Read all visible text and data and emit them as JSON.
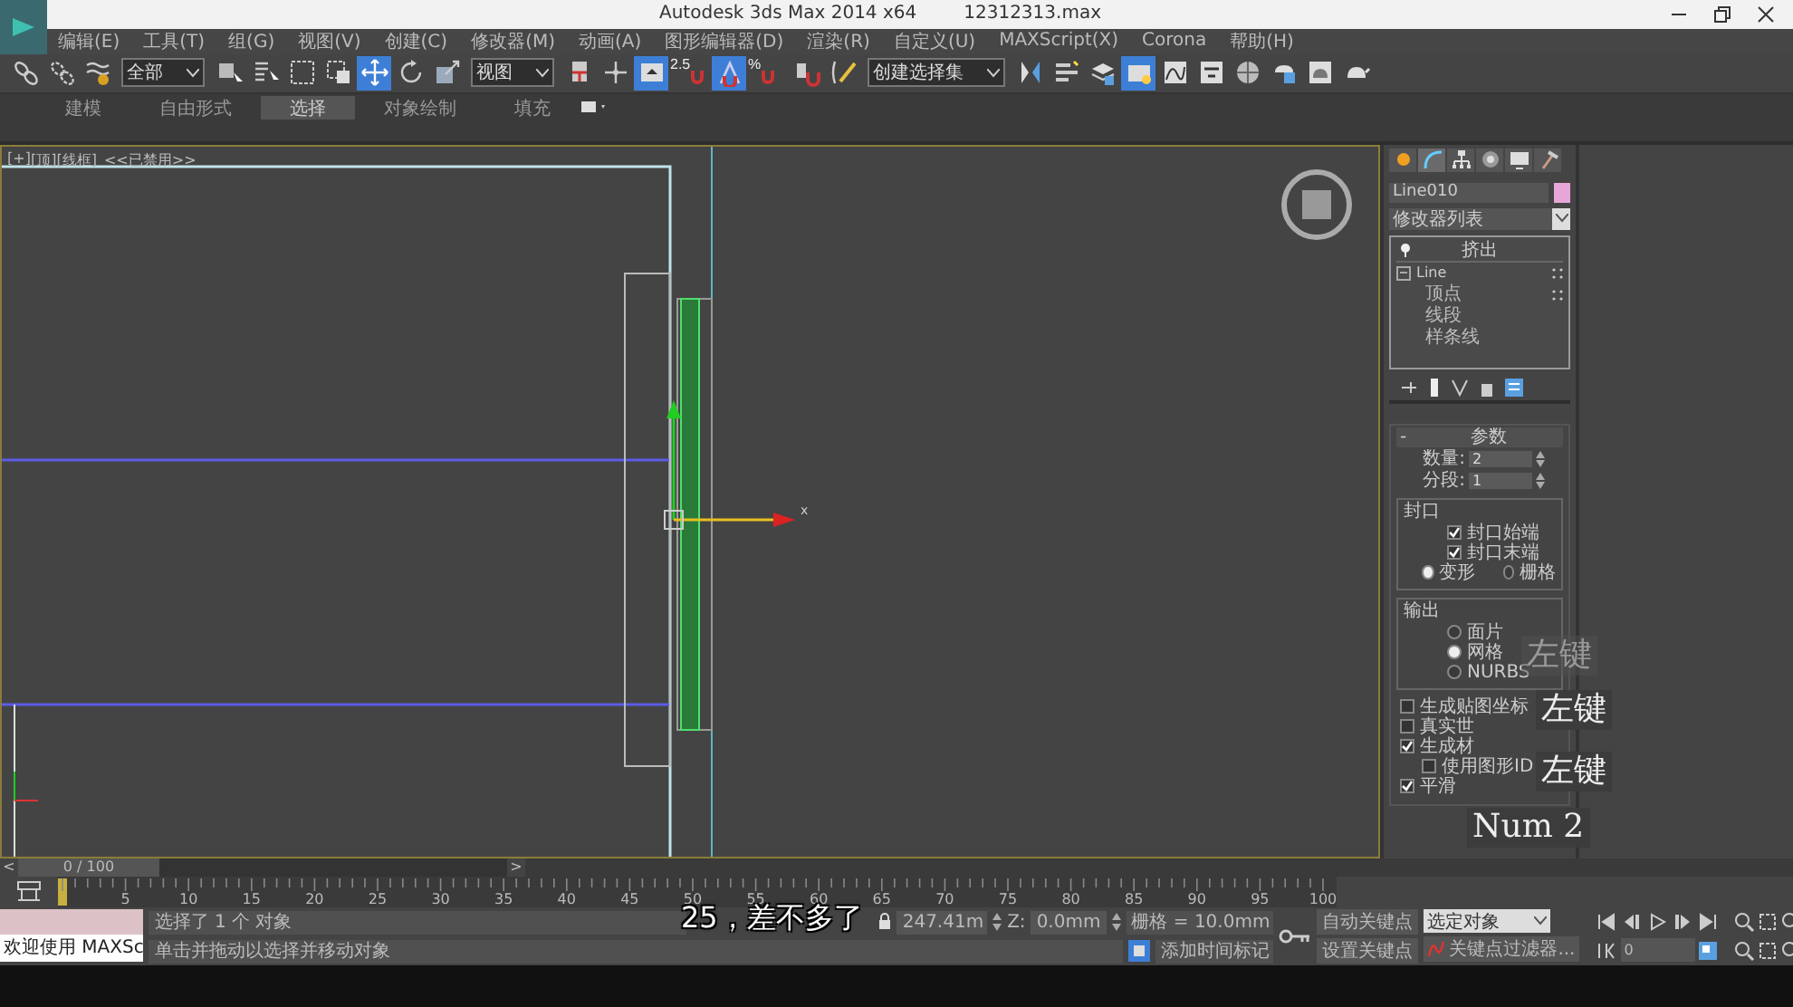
{
  "window": {
    "title": "Autodesk 3ds Max  2014 x64",
    "file": "12312313.max"
  },
  "menu": [
    "编辑(E)",
    "工具(T)",
    "组(G)",
    "视图(V)",
    "创建(C)",
    "修改器(M)",
    "动画(A)",
    "图形编辑器(D)",
    "渲染(R)",
    "自定义(U)",
    "MAXScript(X)",
    "Corona",
    "帮助(H)"
  ],
  "toolbar": [
    {
      "kind": "icon",
      "selected": false
    },
    {
      "kind": "icon",
      "selected": false
    },
    {
      "kind": "icon",
      "selected": false
    },
    {
      "kind": "dropdown",
      "value": "全部"
    },
    {
      "kind": "icon",
      "selected": false
    },
    {
      "kind": "icon",
      "selected": false
    },
    {
      "kind": "icon",
      "selected": false
    },
    {
      "kind": "icon",
      "selected": false
    },
    {
      "kind": "icon",
      "selected": true
    },
    {
      "kind": "icon",
      "selected": false
    },
    {
      "kind": "icon",
      "selected": false
    },
    {
      "kind": "dropdown",
      "value": "视图"
    },
    {
      "kind": "icon",
      "selected": false
    },
    {
      "kind": "icon",
      "selected": false
    },
    {
      "kind": "icon",
      "selected": true
    },
    {
      "kind": "icon",
      "selected": false,
      "label": "2.5"
    },
    {
      "kind": "icon",
      "selected": true
    },
    {
      "kind": "icon",
      "selected": false,
      "label": "%"
    },
    {
      "kind": "icon",
      "selected": false
    },
    {
      "kind": "icon",
      "selected": false
    },
    {
      "kind": "dropdown",
      "value": "创建选择集"
    },
    {
      "kind": "icon",
      "selected": false
    },
    {
      "kind": "icon",
      "selected": false
    },
    {
      "kind": "icon",
      "selected": false
    },
    {
      "kind": "icon",
      "selected": true
    },
    {
      "kind": "icon",
      "selected": false
    },
    {
      "kind": "icon",
      "selected": false
    },
    {
      "kind": "icon",
      "selected": false
    },
    {
      "kind": "icon",
      "selected": false
    },
    {
      "kind": "icon",
      "selected": false
    },
    {
      "kind": "icon",
      "selected": false
    }
  ],
  "ribbon_tabs": [
    {
      "label": "建模",
      "selected": false
    },
    {
      "label": "自由形式",
      "selected": false
    },
    {
      "label": "选择",
      "selected": true
    },
    {
      "label": "对象绘制",
      "selected": false
    },
    {
      "label": "填充",
      "selected": false
    }
  ],
  "viewport": {
    "menus": [
      "[+]",
      "[顶]",
      "[线框]"
    ],
    "note": "<<已禁用>>",
    "gizmo_axis": "x"
  },
  "command_panel": {
    "tabs": [
      {
        "selected": false
      },
      {
        "selected": true
      },
      {
        "selected": false
      },
      {
        "selected": false
      },
      {
        "selected": false
      },
      {
        "selected": false
      }
    ],
    "object_name": "Line010",
    "modifier_list": "修改器列表",
    "stack": [
      {
        "kind": "modifier",
        "label": "挤出"
      },
      {
        "kind": "object",
        "label": "Line",
        "expanded": true,
        "children": [
          {
            "label": "顶点"
          },
          {
            "label": "线段"
          },
          {
            "label": "样条线"
          }
        ]
      }
    ],
    "rollout": {
      "toggle": "-",
      "title": "参数",
      "spinners": [
        {
          "label": "数量:",
          "value": "2"
        },
        {
          "label": "分段:",
          "value": "1"
        }
      ],
      "groups": [
        {
          "title": "封口",
          "rows": [
            {
              "kind": "checkbox",
              "label": "封口始端",
              "checked": true
            },
            {
              "kind": "checkbox",
              "label": "封口末端",
              "checked": true
            },
            {
              "kind": "radios",
              "items": [
                {
                  "label": "变形",
                  "selected": true
                },
                {
                  "label": "栅格",
                  "selected": false
                }
              ]
            }
          ]
        },
        {
          "title": "输出",
          "rows": [
            {
              "kind": "radio",
              "label": "面片",
              "selected": false
            },
            {
              "kind": "radio",
              "label": "网格",
              "selected": true
            },
            {
              "kind": "radio",
              "label": "NURBS",
              "selected": false
            }
          ]
        }
      ],
      "rows": [
        {
          "kind": "checkbox",
          "label": "生成贴图坐标",
          "checked": false
        },
        {
          "kind": "checkbox",
          "label": "真实世",
          "checked": false
        },
        {
          "kind": "checkbox",
          "label": "生成材",
          "checked": true
        },
        {
          "kind": "sub-checkbox",
          "label": "使用图形ID",
          "checked": false
        },
        {
          "kind": "checkbox",
          "label": "平滑",
          "checked": true
        }
      ]
    }
  },
  "key_overlays": [
    {
      "text": "左键",
      "faded": true
    },
    {
      "text": "左键",
      "faded": false
    },
    {
      "text": "左键",
      "faded": false
    },
    {
      "text": "Num 2",
      "faded": false
    }
  ],
  "timeline": {
    "prev": "<",
    "position": "0 / 100",
    "next": ">",
    "level": 0,
    "ruler": [
      "5",
      "10",
      "15",
      "20",
      "25",
      "30",
      "35",
      "40",
      "45",
      "50",
      "55",
      "60",
      "65",
      "70",
      "75",
      "80",
      "85",
      "90",
      "95",
      "100"
    ]
  },
  "status": {
    "listener": "欢迎使用 MAXSc",
    "prompt": "选择了 1 个 对象",
    "hint": "单击并拖动以选择并移动对象",
    "coord_value": "247.41m",
    "z_label": "Z:",
    "z_value": "0.0mm",
    "grid": "栅格 = 10.0mm",
    "time_tag": "添加时间标记",
    "auto_key": "自动关键点",
    "set_key": "设置关键点",
    "key_target": "选定对象",
    "key_filters": "关键点过滤器...",
    "frame": "0"
  },
  "subtitle": "25，差不多了"
}
